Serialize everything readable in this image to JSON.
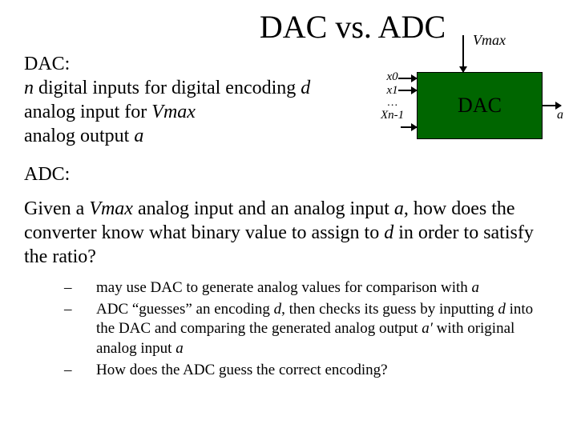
{
  "title": "DAC vs. ADC",
  "dac": {
    "heading": "DAC:",
    "line1_pre": "n",
    "line1_mid": " digital inputs for digital encoding ",
    "line1_post": "d",
    "line2_pre": "analog input for ",
    "line2_post": "Vmax",
    "line3_pre": "analog output ",
    "line3_post": "a"
  },
  "adc": {
    "heading": "ADC:",
    "body_1": "Given a ",
    "body_vmax": "Vmax",
    "body_2": " analog input and an analog input ",
    "body_a": "a",
    "body_3": ", how does the converter know what binary value to assign to ",
    "body_d": "d",
    "body_4": " in order to satisfy the ratio?"
  },
  "bullets": {
    "b1_pre": "may use DAC to generate analog values for comparison with ",
    "b1_a": "a",
    "b2_1": "ADC “guesses” an encoding ",
    "b2_d": "d",
    "b2_2": ", then checks its guess by inputting ",
    "b2_d2": "d",
    "b2_3": " into the DAC and comparing the generated analog output ",
    "b2_aprime": "a′",
    "b2_4": " with original analog input ",
    "b2_a": "a",
    "b3": "How does the ADC guess the correct encoding?"
  },
  "diagram": {
    "vmax": "Vmax",
    "box": "DAC",
    "x0": "x0",
    "x1": "x1",
    "dots": "…",
    "xn": "Xn-1",
    "out": "a"
  }
}
